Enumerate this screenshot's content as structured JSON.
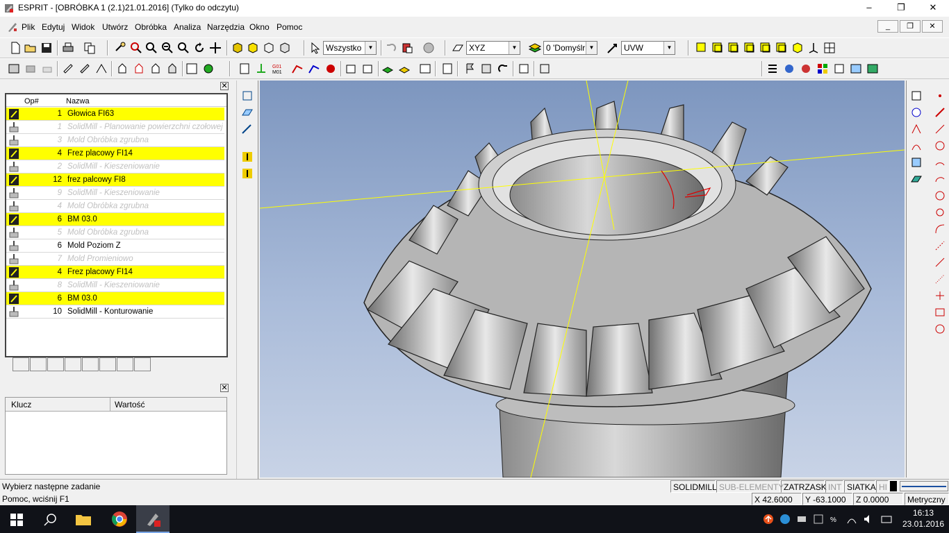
{
  "window": {
    "title": "ESPRIT - [OBRÓBKA 1 (2.1)21.01.2016] (Tylko do odczytu)",
    "minimize_glyph": "–",
    "maximize_glyph": "❐",
    "close_glyph": "✕"
  },
  "menu": {
    "items": [
      "Plik",
      "Edytuj",
      "Widok",
      "Utwórz",
      "Obróbka",
      "Analiza",
      "Narzędzia",
      "Okno",
      "Pomoc"
    ]
  },
  "toolbar1": {
    "filter_combo": "Wszystko",
    "plane_combo": "XYZ",
    "layer_combo": "0 'Domyślr",
    "workplane_combo": "UVW"
  },
  "operations": {
    "columns": [
      "Op#",
      "Nazwa"
    ],
    "rows": [
      {
        "num": "1",
        "name": "Głowica FI63",
        "style": "hl"
      },
      {
        "num": "1",
        "name": "SolidMill - Planowanie powierzchni czołowej",
        "style": "dim"
      },
      {
        "num": "3",
        "name": "Mold Obróbka zgrubna",
        "style": "dim"
      },
      {
        "num": "4",
        "name": "Frez placowy FI14",
        "style": "hl"
      },
      {
        "num": "2",
        "name": "SolidMill - Kieszeniowanie",
        "style": "dim"
      },
      {
        "num": "12",
        "name": "frez palcowy FI8",
        "style": "hl"
      },
      {
        "num": "9",
        "name": "SolidMill - Kieszeniowanie",
        "style": "dim"
      },
      {
        "num": "4",
        "name": "Mold Obróbka zgrubna",
        "style": "dim"
      },
      {
        "num": "6",
        "name": "BM 03.0",
        "style": "hl"
      },
      {
        "num": "5",
        "name": "Mold Obróbka zgrubna",
        "style": "dim"
      },
      {
        "num": "6",
        "name": "Mold Poziom Z",
        "style": "normal"
      },
      {
        "num": "7",
        "name": "Mold Promieniowo",
        "style": "dim"
      },
      {
        "num": "4",
        "name": "Frez placowy FI14",
        "style": "hl"
      },
      {
        "num": "8",
        "name": "SolidMill - Kieszeniowanie",
        "style": "dim"
      },
      {
        "num": "6",
        "name": "BM 03.0",
        "style": "hl"
      },
      {
        "num": "10",
        "name": "SolidMill - Konturowanie",
        "style": "normal"
      }
    ]
  },
  "properties": {
    "columns": [
      "Klucz",
      "Wartość"
    ]
  },
  "status": {
    "message": "Wybierz następne zadanie",
    "help": "Pomoc, wciśnij F1",
    "modes": [
      "SOLIDMILL",
      "SUB-ELEMENTY",
      "ZATRZASK",
      "INT",
      "SIATKA",
      "HI"
    ],
    "x": "X 42.6000",
    "y": "Y -63.1000",
    "z": "Z 0.0000",
    "units": "Metryczny"
  },
  "taskbar": {
    "time": "16:13",
    "date": "23.01.2016"
  },
  "colors": {
    "highlight": "#ffff00",
    "viewport_top": "#7d96bf",
    "viewport_bottom": "#c8d3e6",
    "gear": "#c8c8c8"
  }
}
